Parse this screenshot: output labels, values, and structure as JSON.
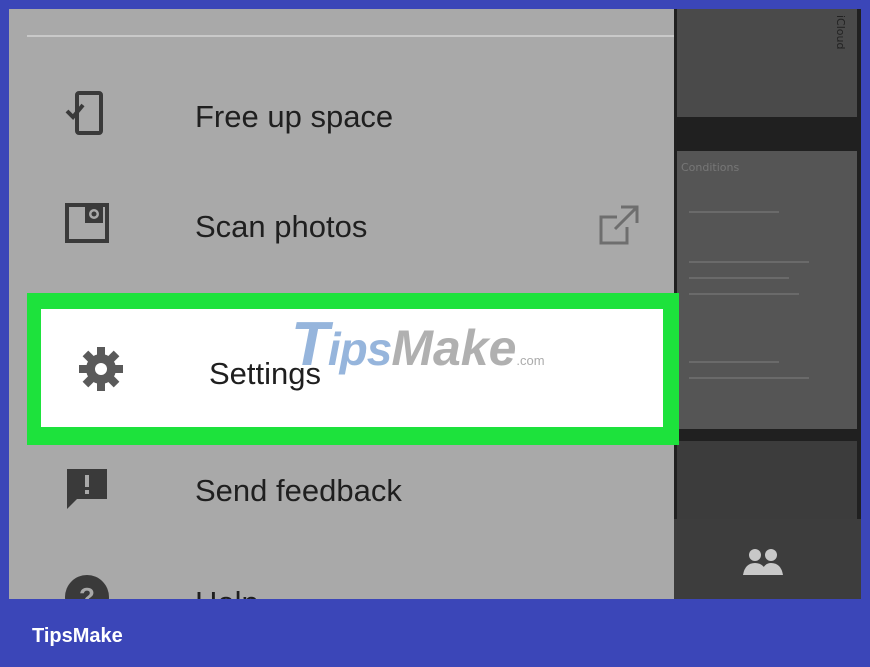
{
  "menu": {
    "items": [
      {
        "label": "Free up space",
        "icon": "phone-check-icon"
      },
      {
        "label": "Scan photos",
        "icon": "photo-scan-icon",
        "trailing_icon": "external-link-icon"
      },
      {
        "label": "Settings",
        "icon": "gear-icon",
        "highlighted": true
      },
      {
        "label": "Send feedback",
        "icon": "feedback-icon"
      },
      {
        "label": "Help",
        "icon": "help-icon"
      }
    ]
  },
  "gallery": {
    "caption_top": "iCloud",
    "caption_mid": "Conditions"
  },
  "watermark": {
    "part1": "T",
    "part2": "ips",
    "part3": "Make",
    "part4": ".com"
  },
  "footer": {
    "brand": "TipsMake"
  },
  "colors": {
    "frame_border": "#3b46b8",
    "highlight": "#1de23c",
    "drawer_bg": "#a9a9a9"
  }
}
